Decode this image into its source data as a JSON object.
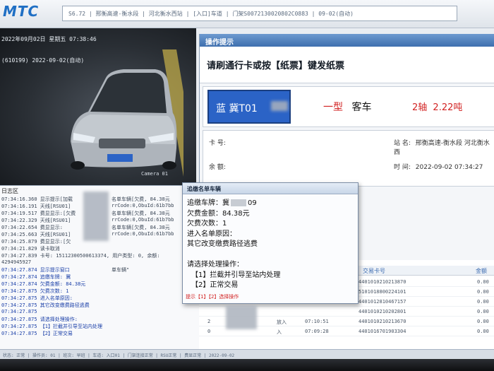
{
  "app": {
    "logo": "MTC",
    "title_bar": "S6.72 | 邢衡高速-衡水段 | 河北衡水西站 | [入口]车道 | 门架S0072130020802C0883 | 09-02(自动)"
  },
  "camera": {
    "timestamp_top": "2022年09月02日 星期五 07:38:46",
    "timestamp_overlay": "(610199) 2022-09-02(自动)",
    "label": "Camera 01"
  },
  "ops": {
    "header": "操作提示",
    "prompt": "请刷通行卡或按【纸票】键发纸票",
    "vehicle": {
      "plate": "蓝  冀T01",
      "type_class": "一型",
      "type_name": "客车",
      "axles": "2轴",
      "weight": "2.22吨"
    },
    "info": {
      "card_label": "卡 号:",
      "balance_label": "余 额:",
      "station_label": "站 名:",
      "station_value": "邢衡高速-衡水段 河北衡水西",
      "time_label": "时 间:",
      "time_value": "2022-09-02 07:34:27"
    }
  },
  "log": {
    "title": "日志区",
    "lines": [
      "07:34:16.360 显示提示[加载",
      "07:34:16.191 天线[RSU01]",
      "07:34:19.517 费显显示:[欠费",
      "07:34:22.329 天线[RSU01]",
      "07:34:22.654 费显显示:",
      "07:34:25.663 天线[RSU01]",
      "07:34:25.879 费显显示:[欠",
      "07:34:21.829 读卡取消",
      "07:34:27.839 卡号: 15112300500613374, 用户类型: 0, 余额:",
      "4294945927",
      "07:34:27.874 显示提示窗口",
      "07:34:27.874 追缴车牌: 冀",
      "07:34:27.874 欠费金额: 84.38元",
      "07:34:27.875 欠费次数: 1",
      "07:34:27.875 进入名单原因:",
      "07:34:27.875 其它改变缴费路径逃费",
      "07:34:27.875",
      "07:34:27.875 请选择处理操作:",
      "07:34:27.875 【1】拦截并引导至站内处理",
      "07:34:27.875 【2】正常交易"
    ],
    "right_fragments": [
      "名单车辆[欠费, 84.38元",
      "rrCode:0,ObuId:61b7bb",
      "名单车辆[欠费, 84.38元",
      "rrCode:0,ObuId:61b7bb",
      "名单车辆[欠费, 84.38元",
      "rrCode:0,ObuId:61b7bb",
      "单车辆\""
    ]
  },
  "dialog": {
    "title": "追缴名单车辆",
    "plate_line": "追缴车牌：冀",
    "plate_suffix": "09",
    "amount_line": "欠费金额：84.38元",
    "count_line": "欠费次数：1",
    "reason_label": "进入名单原因：",
    "reason_value": "其它改变缴费路径逃费",
    "choose_label": "请选择处理操作：",
    "option_1": "【1】拦截并引导至站内处理",
    "option_2": "【2】正常交易",
    "footer": "提示【1】【2】选择操作"
  },
  "table": {
    "headers": [
      "交易卡号",
      "金额"
    ],
    "rows": [
      {
        "col1": "",
        "col2": "",
        "col3": "",
        "card": "4401010210213870",
        "amount": "0.00"
      },
      {
        "col1": "",
        "col2": "",
        "col3": "",
        "card": "5101018800224101",
        "amount": "0.00"
      },
      {
        "col1": "",
        "col2": "",
        "col3": "",
        "card": "4401012810467157",
        "amount": "0.00"
      },
      {
        "col1": "",
        "col2": "",
        "col3": "",
        "card": "4401010210202801",
        "amount": "0.00"
      },
      {
        "col1": "2",
        "col2": "放入",
        "col3": "07:10:51",
        "card": "4401010210213670",
        "amount": "0.00"
      },
      {
        "col1": "0",
        "col2": "入",
        "col3": "07:09:28",
        "card": "4401016701903304",
        "amount": "0.00"
      }
    ]
  },
  "status_bar": "状态: 正常 | 操作员: 01 | 班次: 早班 | 车道: 入口01 | 门架连接正常 | RSU正常 | 费显正常 | 2022-09-02"
}
